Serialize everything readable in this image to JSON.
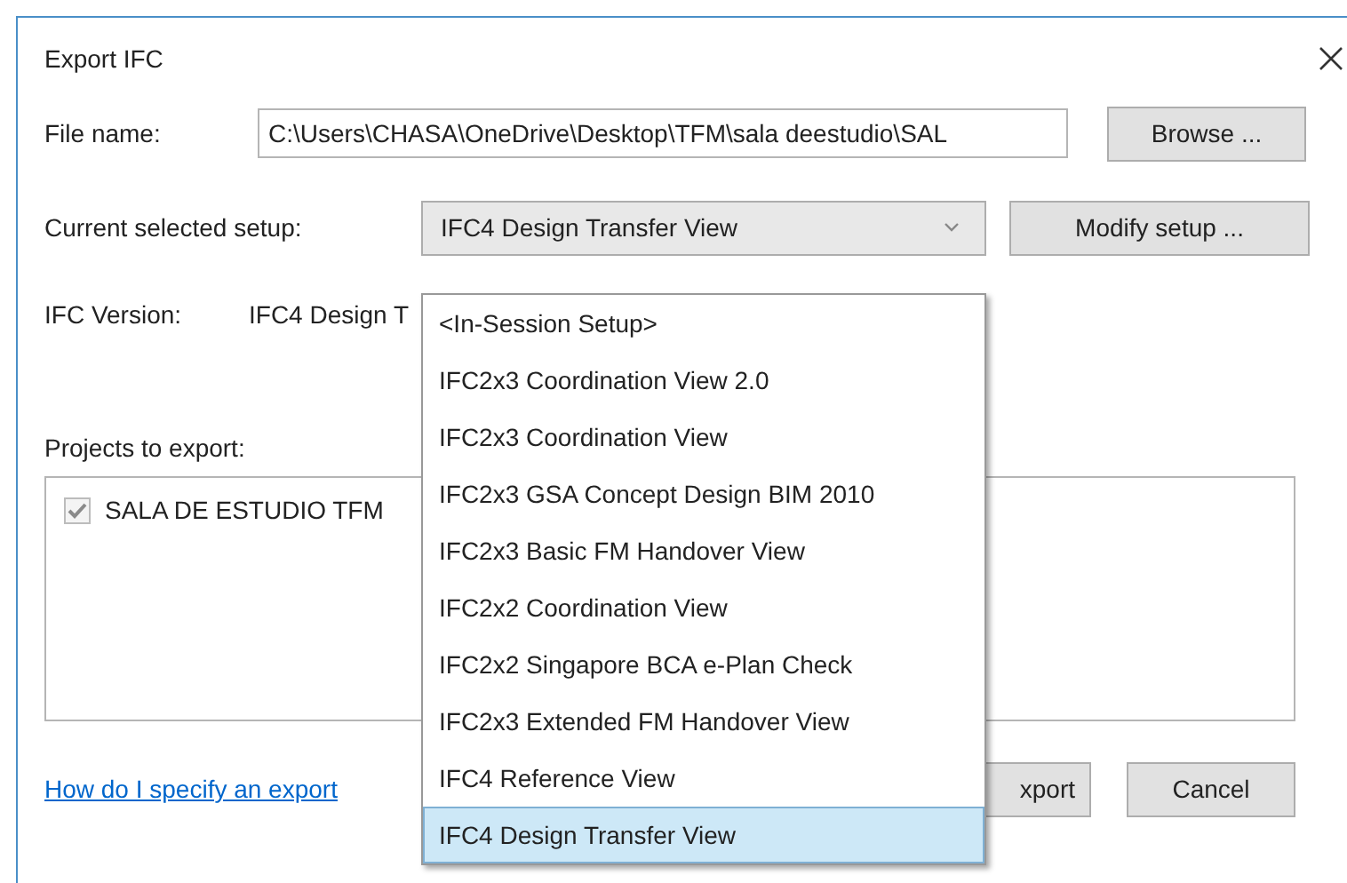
{
  "window": {
    "title": "Export IFC"
  },
  "file_name": {
    "label": "File name:",
    "value": "C:\\Users\\CHASA\\OneDrive\\Desktop\\TFM\\sala deestudio\\SAL",
    "button": "Browse ..."
  },
  "setup": {
    "label": "Current selected setup:",
    "value": "IFC4 Design Transfer View",
    "button": "Modify setup ...",
    "expanded": true,
    "options": [
      {
        "label": "<In-Session Setup>",
        "selected": false
      },
      {
        "label": "IFC2x3 Coordination View 2.0",
        "selected": false
      },
      {
        "label": "IFC2x3 Coordination View",
        "selected": false
      },
      {
        "label": "IFC2x3 GSA Concept Design BIM 2010",
        "selected": false
      },
      {
        "label": "IFC2x3 Basic FM Handover View",
        "selected": false
      },
      {
        "label": "IFC2x2 Coordination View",
        "selected": false
      },
      {
        "label": "IFC2x2 Singapore BCA e-Plan Check",
        "selected": false
      },
      {
        "label": "IFC2x3 Extended FM Handover View",
        "selected": false
      },
      {
        "label": "IFC4 Reference View",
        "selected": false
      },
      {
        "label": "IFC4 Design Transfer View",
        "selected": true
      }
    ]
  },
  "ifc_version": {
    "label": "IFC Version:",
    "value": "IFC4 Design T"
  },
  "projects": {
    "label": "Projects to export:",
    "items": [
      {
        "label": "SALA DE ESTUDIO TFM",
        "checked": true
      }
    ]
  },
  "help_link": "How do I specify an export",
  "buttons": [
    "xport",
    "Cancel"
  ]
}
